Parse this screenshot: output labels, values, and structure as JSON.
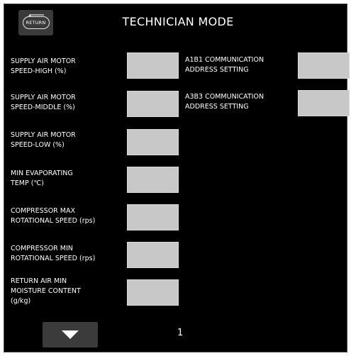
{
  "header": {
    "return_label": "RETURN",
    "title": "TECHNICIAN MODE"
  },
  "left_params": [
    {
      "line1": "SUPPLY AIR MOTOR",
      "line2": "SPEED-HIGH (%)",
      "line3": ""
    },
    {
      "line1": "SUPPLY AIR MOTOR",
      "line2": "SPEED-MIDDLE (%)",
      "line3": ""
    },
    {
      "line1": "SUPPLY AIR MOTOR",
      "line2": "SPEED-LOW (%)",
      "line3": ""
    },
    {
      "line1": "MIN EVAPORATING",
      "line2": "TEMP (℃)",
      "line3": ""
    },
    {
      "line1": "COMPRESSOR MAX",
      "line2": "ROTATIONAL SPEED (rps)",
      "line3": ""
    },
    {
      "line1": "COMPRESSOR MIN",
      "line2": "ROTATIONAL SPEED (rps)",
      "line3": ""
    },
    {
      "line1": "RETURN AIR MIN",
      "line2": "MOISTURE CONTENT",
      "line3": "(g/kg)"
    }
  ],
  "right_params": [
    {
      "line1": "A1B1 COMMUNICATION",
      "line2": "ADDRESS SETTING"
    },
    {
      "line1": "A3B3 COMMUNICATION",
      "line2": "ADDRESS SETTING"
    }
  ],
  "footer": {
    "page_number": "1",
    "next_icon": "down-triangle-icon"
  }
}
